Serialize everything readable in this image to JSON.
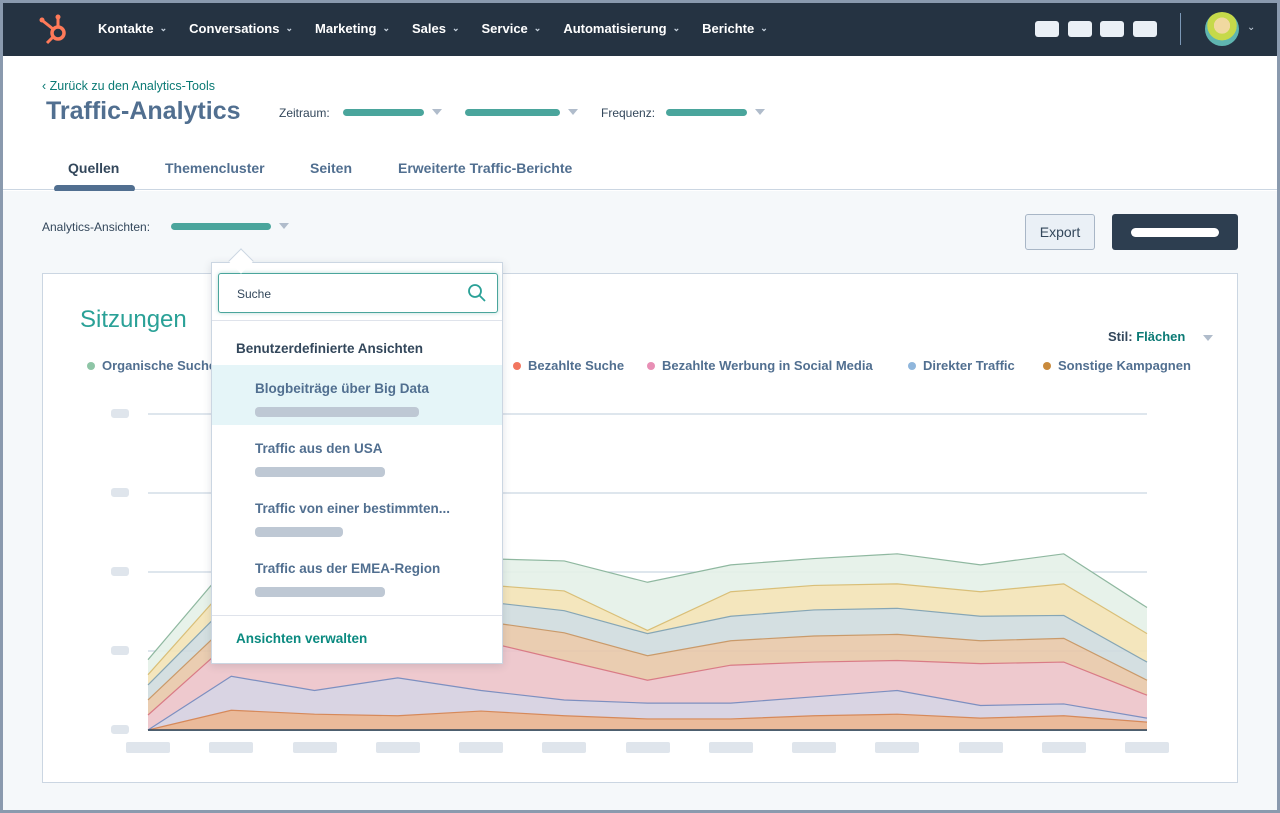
{
  "nav": {
    "logo": "hubspot-sprocket-logo",
    "items": [
      {
        "label": "Kontakte"
      },
      {
        "label": "Conversations"
      },
      {
        "label": "Marketing"
      },
      {
        "label": "Sales"
      },
      {
        "label": "Service"
      },
      {
        "label": "Automatisierung"
      },
      {
        "label": "Berichte"
      }
    ]
  },
  "header": {
    "back_link": "Zurück zu den Analytics-Tools",
    "title": "Traffic-Analytics",
    "zeitraum_label": "Zeitraum:",
    "frequenz_label": "Frequenz:"
  },
  "tabs": [
    {
      "label": "Quellen",
      "active": true
    },
    {
      "label": "Themencluster"
    },
    {
      "label": "Seiten"
    },
    {
      "label": "Erweiterte Traffic-Berichte"
    }
  ],
  "toolbar": {
    "views_label": "Analytics-Ansichten:",
    "export_label": "Export"
  },
  "card": {
    "title": "Sitzungen",
    "style_label": "Stil:",
    "style_value": "Flächen"
  },
  "legend": [
    {
      "label": "Organische Suche",
      "color": "#8ec5a6"
    },
    {
      "label": "Bezahlte Suche",
      "color": "#f2765f"
    },
    {
      "label": "Bezahlte Werbung in Social Media",
      "color": "#e88fb5"
    },
    {
      "label": "Direkter Traffic",
      "color": "#8fb6dc"
    },
    {
      "label": "Sonstige Kampagnen",
      "color": "#c98a3c"
    }
  ],
  "dropdown": {
    "search_placeholder": "Suche",
    "section_title": "Benutzerdefinierte Ansichten",
    "items": [
      {
        "label": "Blogbeiträge über Big Data",
        "selected": true
      },
      {
        "label": "Traffic aus den USA"
      },
      {
        "label": "Traffic von einer bestimmten..."
      },
      {
        "label": "Traffic aus der EMEA-Region"
      }
    ],
    "manage_label": "Ansichten verwalten"
  },
  "chart_data": {
    "type": "area",
    "stacked": true,
    "grid": true,
    "ylim": [
      0,
      4
    ],
    "x": [
      1,
      2,
      3,
      4,
      5,
      6,
      7,
      8,
      9,
      10,
      11,
      12,
      13
    ],
    "series": [
      {
        "fill": "#e8b28f",
        "line": "#d6895a",
        "values": [
          0,
          0.25,
          0.2,
          0.18,
          0.24,
          0.18,
          0.14,
          0.14,
          0.18,
          0.2,
          0.15,
          0.18,
          0.1
        ]
      },
      {
        "fill": "#d5cfe0",
        "line": "#7d8fc0",
        "values": [
          0,
          0.43,
          0.3,
          0.48,
          0.26,
          0.2,
          0.2,
          0.2,
          0.24,
          0.3,
          0.16,
          0.15,
          0.05
        ]
      },
      {
        "fill": "#ecc3c9",
        "line": "#d97b86",
        "values": [
          0.19,
          0.45,
          0.56,
          0.41,
          0.63,
          0.5,
          0.29,
          0.48,
          0.44,
          0.38,
          0.53,
          0.53,
          0.29
        ]
      },
      {
        "fill": "#e8c8a8",
        "line": "#c99a6a",
        "values": [
          0.19,
          0.25,
          0.29,
          0.25,
          0.25,
          0.35,
          0.31,
          0.31,
          0.33,
          0.33,
          0.29,
          0.3,
          0.19
        ]
      },
      {
        "fill": "#cfdcde",
        "line": "#86a6b5",
        "values": [
          0.19,
          0.25,
          0.24,
          0.25,
          0.25,
          0.28,
          0.28,
          0.31,
          0.33,
          0.33,
          0.31,
          0.29,
          0.23
        ]
      },
      {
        "fill": "#f3e3b6",
        "line": "#d9bf78",
        "values": [
          0.13,
          0.25,
          0.23,
          0.24,
          0.21,
          0.25,
          0.04,
          0.31,
          0.31,
          0.31,
          0.31,
          0.4,
          0.36
        ]
      },
      {
        "fill": "#e4f1e8",
        "line": "#8fb8a0",
        "values": [
          0.19,
          0.25,
          0.35,
          0.36,
          0.33,
          0.38,
          0.61,
          0.34,
          0.34,
          0.38,
          0.34,
          0.38,
          0.33
        ]
      }
    ]
  }
}
